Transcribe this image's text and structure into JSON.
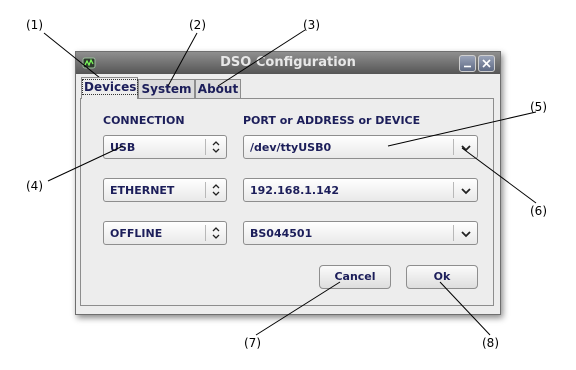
{
  "annotations": [
    "(1)",
    "(2)",
    "(3)",
    "(4)",
    "(5)",
    "(6)",
    "(7)",
    "(8)"
  ],
  "window": {
    "title": "DSO Configuration"
  },
  "tabs": [
    {
      "label": "Devices",
      "active": true
    },
    {
      "label": "System",
      "active": false
    },
    {
      "label": "About",
      "active": false
    }
  ],
  "headers": {
    "connection": "CONNECTION",
    "port": "PORT or ADDRESS or DEVICE"
  },
  "rows": [
    {
      "connection": "USB",
      "port": "/dev/ttyUSB0"
    },
    {
      "connection": "ETHERNET",
      "port": "192.168.1.142"
    },
    {
      "connection": "OFFLINE",
      "port": "BS044501"
    }
  ],
  "buttons": {
    "cancel": "Cancel",
    "ok": "Ok"
  },
  "icons": [
    "app-icon",
    "minimize-icon",
    "close-icon",
    "spin-updown-icon",
    "chevron-down-icon"
  ],
  "colors": {
    "text_accent": "#1c1e5a",
    "titlebar": "#6b6b6b",
    "dialog_bg": "#ededed"
  }
}
